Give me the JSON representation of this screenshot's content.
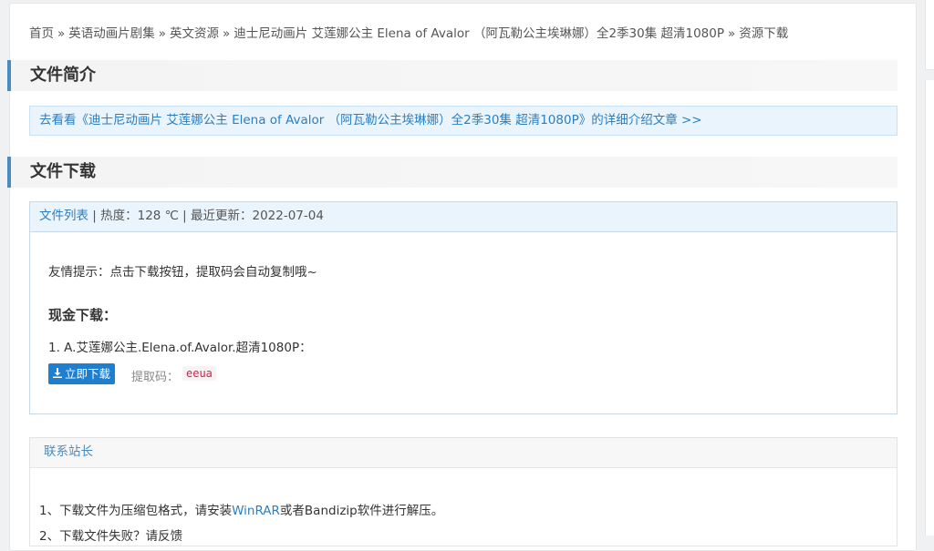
{
  "breadcrumb": {
    "items": [
      "首页",
      "英语动画片剧集",
      "英文资源",
      "迪士尼动画片 艾莲娜公主 Elena of Avalor （阿瓦勒公主埃琳娜）全2季30集 超清1080P",
      "资源下载"
    ],
    "separator": "»"
  },
  "intro": {
    "title": "文件简介",
    "link_text": "去看看《迪士尼动画片 艾莲娜公主 Elena of Avalor （阿瓦勒公主埃琳娜）全2季30集 超清1080P》的详细介绍文章 >>"
  },
  "download": {
    "title": "文件下载",
    "head_link": "文件列表",
    "head_meta": " | 热度：128 ℃ | 最近更新：2022-07-04",
    "tip": "友情提示：点击下载按钮，提取码会自动复制哦~",
    "cash_title": "现金下载：",
    "item": "1. A.艾莲娜公主.Elena.of.Avalor.超清1080P：",
    "button_label": "立即下载",
    "code_label": "提取码：",
    "code_value": "eeua"
  },
  "contact": {
    "title": "联系站长",
    "note1_prefix": "1、下载文件为压缩包格式，请安装",
    "note1_link": "WinRAR",
    "note1_suffix": "或者Bandizip软件进行解压。",
    "note2": "2、下载文件失败？请反馈"
  },
  "colors": {
    "accent": "#4b8bbd",
    "link": "#2b7ec2",
    "button": "#1e7ecf"
  },
  "icons": {
    "download": "download-icon"
  }
}
